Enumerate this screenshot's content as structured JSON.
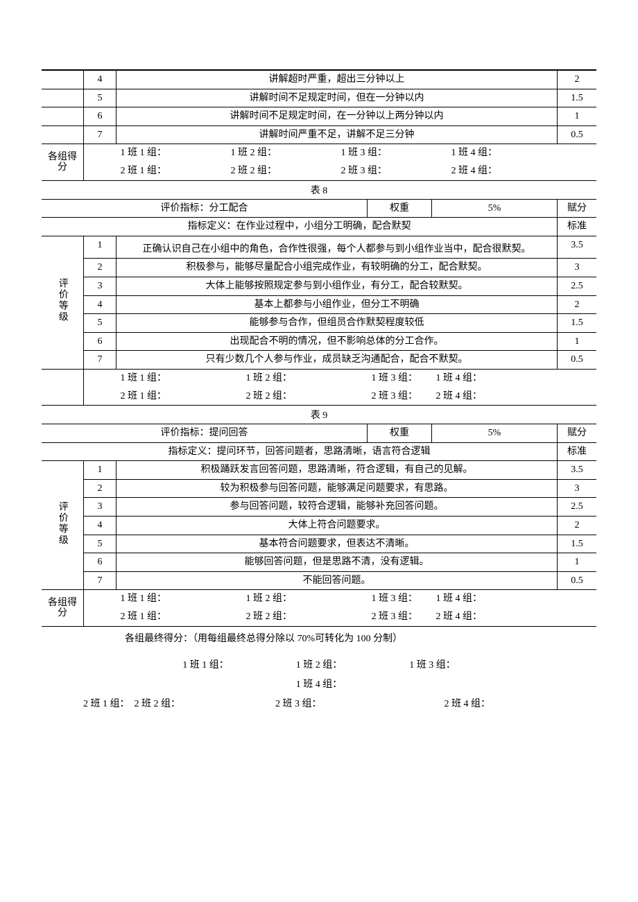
{
  "table7": {
    "levels": [
      {
        "n": "4",
        "desc": "讲解超时严重，超出三分钟以上",
        "score": "2"
      },
      {
        "n": "5",
        "desc": "讲解时间不足规定时间，但在一分钟以内",
        "score": "1.5"
      },
      {
        "n": "6",
        "desc": "讲解时间不足规定时间，在一分钟以上两分钟以内",
        "score": "1"
      },
      {
        "n": "7",
        "desc": "讲解时间严重不足，讲解不足三分钟",
        "score": "0.5"
      }
    ],
    "group_score_label": "各组得分",
    "groups_row1": [
      "1 班 1 组：",
      "1 班 2 组：",
      "1 班 3 组：",
      "1 班 4 组："
    ],
    "groups_row2": [
      "2 班 1 组：",
      "2 班 2 组：",
      "2 班 3 组：",
      "2 班 4 组："
    ]
  },
  "table8": {
    "caption": "表 8",
    "indicator_label": "评价指标：分工配合",
    "weight_label": "权重",
    "weight_value": "5%",
    "fu_fen": "赋分",
    "biao_zhun": "标准",
    "definition": "指标定义：在作业过程中，小组分工明确，配合默契",
    "level_label": "评价等级",
    "levels": [
      {
        "n": "1",
        "desc": "正确认识自己在小组中的角色，合作性很强，每个人都参与到小组作业当中，配合很默契。",
        "score": "3.5"
      },
      {
        "n": "2",
        "desc": "积极参与，能够尽量配合小组完成作业，有较明确的分工，配合默契。",
        "score": "3"
      },
      {
        "n": "3",
        "desc": "大体上能够按照规定参与到小组作业，有分工，配合较默契。",
        "score": "2.5"
      },
      {
        "n": "4",
        "desc": "基本上都参与小组作业，但分工不明确",
        "score": "2"
      },
      {
        "n": "5",
        "desc": "能够参与合作，但组员合作默契程度较低",
        "score": "1.5"
      },
      {
        "n": "6",
        "desc": "出现配合不明的情况，但不影响总体的分工合作。",
        "score": "1"
      },
      {
        "n": "7",
        "desc": "只有少数几个人参与作业，成员缺乏沟通配合，配合不默契。",
        "score": "0.5"
      }
    ],
    "groups_row1": [
      "1 班 1 组：",
      "1 班 2 组：",
      "1 班 3 组：",
      "1 班 4 组："
    ],
    "groups_row2": [
      "2 班 1 组：",
      "2 班 2 组：",
      "2 班 3 组：",
      "2 班 4 组："
    ]
  },
  "table9": {
    "caption": "表 9",
    "indicator_label": "评价指标：提问回答",
    "weight_label": "权重",
    "weight_value": "5%",
    "fu_fen": "赋分",
    "biao_zhun": "标准",
    "definition": "指标定义：提问环节，回答问题者，思路清晰，语言符合逻辑",
    "level_label": "评价等级",
    "levels": [
      {
        "n": "1",
        "desc": "积极踊跃发言回答问题，思路清晰，符合逻辑，有自己的见解。",
        "score": "3.5"
      },
      {
        "n": "2",
        "desc": "较为积极参与回答问题，能够满足问题要求，有思路。",
        "score": "3"
      },
      {
        "n": "3",
        "desc": "参与回答问题，较符合逻辑，能够补充回答问题。",
        "score": "2.5"
      },
      {
        "n": "4",
        "desc": "大体上符合问题要求。",
        "score": "2"
      },
      {
        "n": "5",
        "desc": "基本符合问题要求，但表达不清晰。",
        "score": "1.5"
      },
      {
        "n": "6",
        "desc": "能够回答问题，但是思路不清，没有逻辑。",
        "score": "1"
      },
      {
        "n": "7",
        "desc": "不能回答问题。",
        "score": "0.5"
      }
    ],
    "group_score_label": "各组得分",
    "groups_row1": [
      "1 班 1 组：",
      "1 班 2 组：",
      "1 班 3 组：",
      "1 班 4 组："
    ],
    "groups_row2": [
      "2 班 1 组：",
      "2 班 2 组：",
      "2 班 3 组：",
      "2 班 4 组："
    ]
  },
  "final": {
    "note": "各组最终得分：（用每组最终总得分除以 70%可转化为 100 分制）",
    "row1": [
      "1 班 1 组：",
      "1 班 2 组：",
      "1 班 3 组："
    ],
    "row1b": "1 班 4 组：",
    "row2_prefix": "2 班 1 组：",
    "row2": [
      "2 班 2 组：",
      "2 班 3 组：",
      "2 班 4 组："
    ]
  }
}
